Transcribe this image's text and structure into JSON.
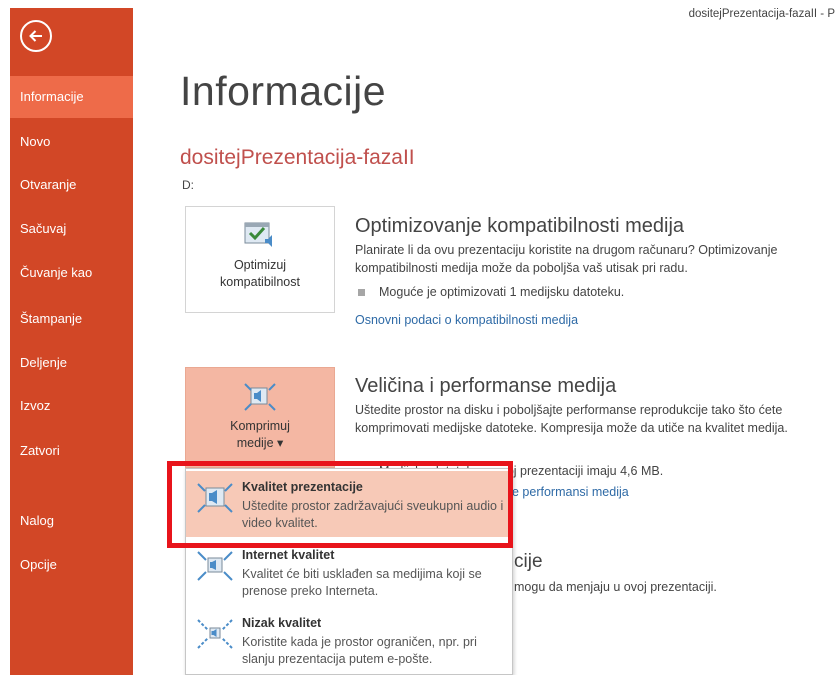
{
  "window_title": "dositejPrezentacija-fazaII - P",
  "sidebar": {
    "items": [
      {
        "label": "Informacije"
      },
      {
        "label": "Novo"
      },
      {
        "label": "Otvaranje"
      },
      {
        "label": "Sačuvaj"
      },
      {
        "label": "Čuvanje kao"
      },
      {
        "label": "Štampanje"
      },
      {
        "label": "Deljenje"
      },
      {
        "label": "Izvoz"
      },
      {
        "label": "Zatvori"
      },
      {
        "label": "Nalog"
      },
      {
        "label": "Opcije"
      }
    ],
    "active_index": 0
  },
  "main": {
    "title": "Informacije",
    "doc_name": "dositejPrezentacija-fazaII",
    "doc_path": "D:",
    "optimize": {
      "button_label_1": "Optimizuj",
      "button_label_2": "kompatibilnost",
      "title": "Optimizovanje kompatibilnosti medija",
      "description": "Planirate li da ovu prezentaciju koristite na drugom računaru? Optimizovanje kompatibilnosti medija može da poboljša vaš utisak pri radu.",
      "bullet": "Moguće je optimizovati 1 medijsku datoteku.",
      "link": "Osnovni podaci o kompatibilnosti medija"
    },
    "size": {
      "button_label_1": "Komprimuj",
      "button_label_2": "medije ▾",
      "title": "Veličina i performanse medija",
      "description": "Uštedite prostor na disku i poboljšajte performanse reprodukcije tako što ćete komprimovati medijske datoteke. Kompresija može da utiče na kvalitet medija.",
      "bullet": "Medijske datoteke u ovoj prezentaciji imaju 4,6 MB.",
      "link": "e performansi medija"
    },
    "section3": {
      "title": "cije",
      "description": "mogu da menjaju u ovoj prezentaciji."
    }
  },
  "dropdown": {
    "options": [
      {
        "title": "Kvalitet prezentacije",
        "description": "Uštedite prostor zadržavajući sveukupni audio i video kvalitet."
      },
      {
        "title": "Internet kvalitet",
        "description": "Kvalitet će biti usklađen sa medijima koji se prenose preko Interneta."
      },
      {
        "title": "Nizak kvalitet",
        "description": "Koristite kada je prostor ograničen, npr. pri slanju prezentacija putem e-pošte."
      }
    ],
    "selected_index": 0
  },
  "colors": {
    "sidebar": "#d24726",
    "sidebar_active": "#ee6b49",
    "doc_name": "#c0504d",
    "link": "#2e6aa6",
    "selected_option": "#f7c9b7",
    "highlight": "#e8141b"
  }
}
